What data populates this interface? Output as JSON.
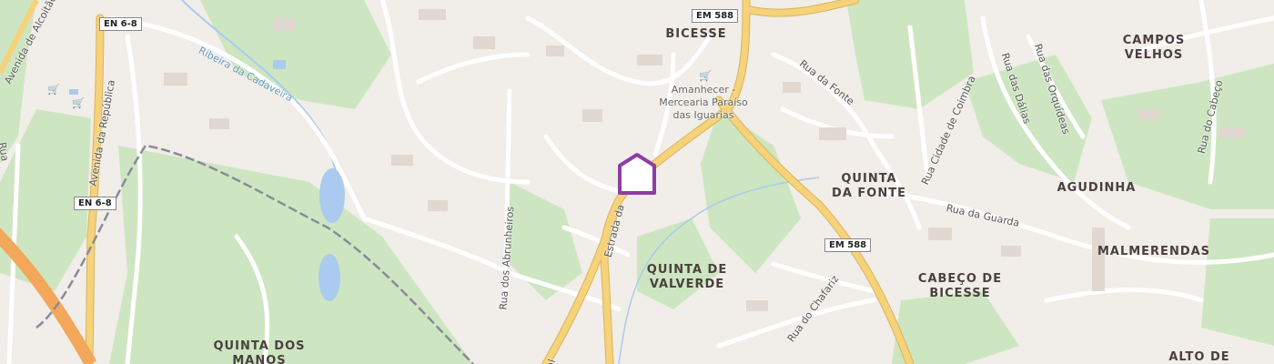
{
  "places": {
    "bicesse": "BICESSE",
    "campos_velhos": "CAMPOS\nVELHOS",
    "quinta_da_fonte": "QUINTA\nDA FONTE",
    "agudinha": "AGUDINHA",
    "malmerendas": "MALMERENDAS",
    "quinta_de_valverde": "QUINTA DE\nVALVERDE",
    "cabeco_de_bicesse": "CABEÇO DE\nBICESSE",
    "quinta_dos_manos": "QUINTA DOS\nMANOS",
    "alto_de": "ALTO DE"
  },
  "streets": {
    "av_alcoitao": "Avenida de Alcoitão",
    "av_republica": "Avenida da República",
    "rua_left": "Rua",
    "ribeira": "Ribeira da Cadaveira",
    "rua_abrunheiros": "Rua dos Abrunheiros",
    "estrada": "Estrada da",
    "rua_da_fonte": "Rua da Fonte",
    "rua_cidade_coimbra": "Rua Cidade de Coimbra",
    "rua_dalias": "Rua das Dálias",
    "rua_orquideas": "Rua das Orquídeas",
    "rua_cabeco": "Rua do Cabeço",
    "rua_guarda": "Rua da Guarda",
    "rua_chafariz": "Rua do Chafariz",
    "bottom_al": "al"
  },
  "road_refs": {
    "em588_top": "EM 588",
    "em588_mid": "EM 588",
    "en68_top": "EN 6-8",
    "en68_mid": "EN 6-8"
  },
  "poi": {
    "grocery": "Amanhecer -\nMercearia Paraíso\ndas Iguarias"
  },
  "icons": {
    "marker": "home-marker-icon",
    "shop": "shopping-basket-icon"
  },
  "colors": {
    "background": "#f1ede8",
    "green": "#cde6c1",
    "major_road": "#f6d27a",
    "road_casing": "#d9b45a",
    "minor_road": "#ffffff",
    "highway": "#f3a75a",
    "water": "#aacbef",
    "rail": "#8a8a9a",
    "marker": "#8e3ca6"
  }
}
